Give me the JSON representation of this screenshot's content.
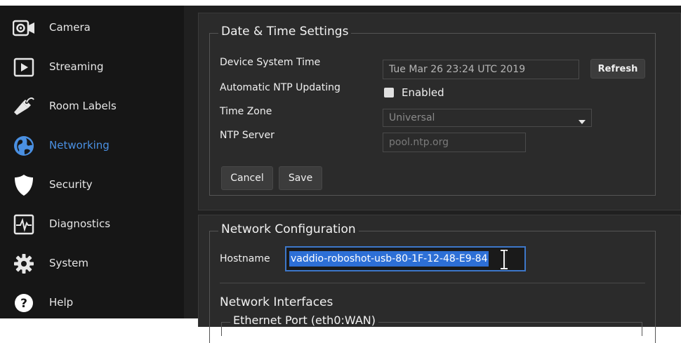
{
  "sidebar": {
    "items": [
      {
        "label": "Camera",
        "icon": "camera-icon",
        "active": false
      },
      {
        "label": "Streaming",
        "icon": "play-icon",
        "active": false
      },
      {
        "label": "Room Labels",
        "icon": "tag-icon",
        "active": false
      },
      {
        "label": "Networking",
        "icon": "globe-icon",
        "active": true
      },
      {
        "label": "Security",
        "icon": "shield-icon",
        "active": false
      },
      {
        "label": "Diagnostics",
        "icon": "pulse-icon",
        "active": false
      },
      {
        "label": "System",
        "icon": "gear-icon",
        "active": false
      },
      {
        "label": "Help",
        "icon": "help-icon",
        "active": false
      }
    ]
  },
  "datetime": {
    "legend": "Date & Time Settings",
    "device_time_label": "Device System Time",
    "device_time_value": "Tue Mar 26 23:24 UTC 2019",
    "refresh_label": "Refresh",
    "ntp_label": "Automatic NTP Updating",
    "ntp_checkbox_label": "Enabled",
    "timezone_label": "Time Zone",
    "timezone_value": "Universal",
    "ntp_server_label": "NTP Server",
    "ntp_server_placeholder": "pool.ntp.org",
    "cancel_label": "Cancel",
    "save_label": "Save"
  },
  "network": {
    "legend": "Network Configuration",
    "hostname_label": "Hostname",
    "hostname_value": "vaddio-roboshot-usb-80-1F-12-48-E9-84",
    "interfaces_title": "Network Interfaces",
    "ethernet_legend": "Ethernet Port (eth0:WAN)"
  },
  "colors": {
    "accent": "#4a90e2",
    "selection": "#2d6fd6"
  }
}
